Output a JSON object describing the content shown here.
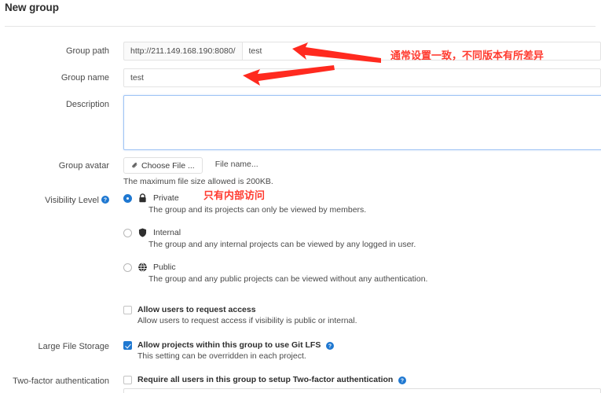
{
  "page": {
    "title": "New group"
  },
  "colors": {
    "annotation_red": "#ff3b30",
    "accent_blue": "#1f78d1",
    "focus_border": "#a0c4f5"
  },
  "form": {
    "group_path": {
      "label": "Group path",
      "prefix": "http://211.149.168.190:8080/",
      "value": "test",
      "placeholder": ""
    },
    "group_name": {
      "label": "Group name",
      "value": "test",
      "placeholder": ""
    },
    "description": {
      "label": "Description",
      "value": "",
      "placeholder": ""
    },
    "group_avatar": {
      "label": "Group avatar",
      "choose_button": "Choose File ...",
      "file_name": "File name...",
      "hint": "The maximum file size allowed is 200KB."
    },
    "visibility": {
      "label": "Visibility Level",
      "help_icon": "help-circle-icon",
      "options": [
        {
          "title": "Private",
          "icon": "lock-icon",
          "description": "The group and its projects can only be viewed by members.",
          "selected": true
        },
        {
          "title": "Internal",
          "icon": "shield-icon",
          "description": "The group and any internal projects can be viewed by any logged in user.",
          "selected": false
        },
        {
          "title": "Public",
          "icon": "globe-icon",
          "description": "The group and any public projects can be viewed without any authentication.",
          "selected": false
        }
      ],
      "request_access": {
        "label": "Allow users to request access",
        "description": "Allow users to request access if visibility is public or internal.",
        "checked": false
      }
    },
    "lfs": {
      "label": "Large File Storage",
      "checkbox_label": "Allow projects within this group to use Git LFS",
      "description": "This setting can be overridden in each project.",
      "checked": true,
      "help_icon": "help-circle-icon"
    },
    "two_factor": {
      "label": "Two-factor authentication",
      "checkbox_label": "Require all users in this group to setup Two-factor authentication",
      "checked": false,
      "help_icon": "help-circle-icon"
    }
  },
  "annotations": {
    "path_note": "通常设置一致，不同版本有所差异",
    "visibility_note": "只有内部访问",
    "arrows": [
      {
        "name": "arrow-to-group-path",
        "points_to": "group-path-input"
      },
      {
        "name": "arrow-to-group-name",
        "points_to": "group-name-input"
      }
    ]
  }
}
